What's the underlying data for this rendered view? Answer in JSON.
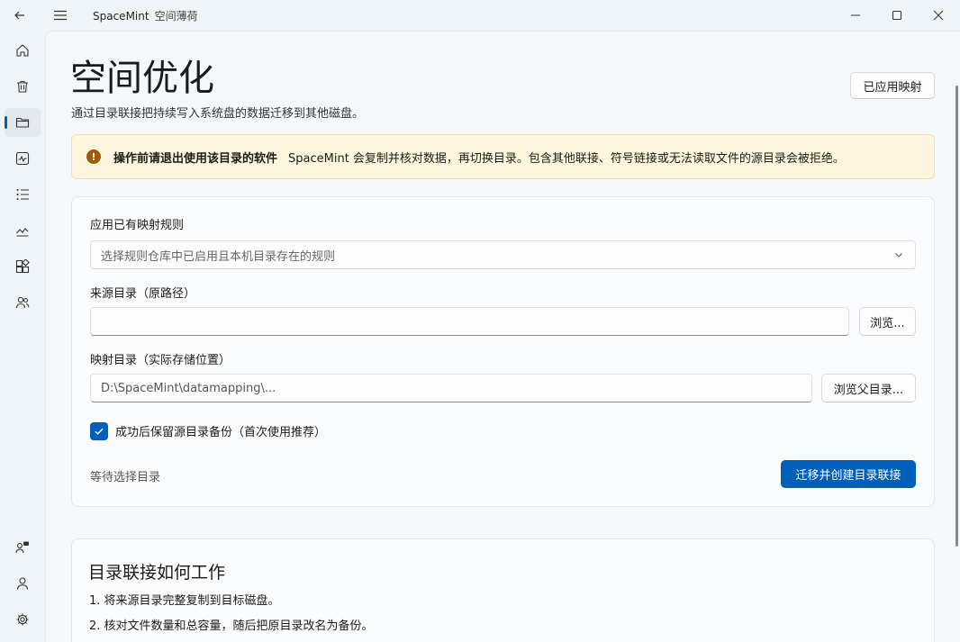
{
  "app": {
    "name": "SpaceMint",
    "subtitle": "空间薄荷"
  },
  "page": {
    "title": "空间优化",
    "description": "通过目录联接把持续写入系统盘的数据迁移到其他磁盘。",
    "applied_button": "已应用映射"
  },
  "warning": {
    "icon": "warning-icon",
    "title": "操作前请退出使用该目录的软件",
    "message": "SpaceMint 会复制并核对数据，再切换目录。包含其他联接、符号链接或无法读取文件的源目录会被拒绝。"
  },
  "form": {
    "rule_label": "应用已有映射规则",
    "rule_placeholder": "选择规则仓库中已启用且本机目录存在的规则",
    "source_label": "来源目录（原路径）",
    "source_value": "",
    "browse_label": "浏览...",
    "mapping_label": "映射目录（实际存储位置）",
    "mapping_value": "D:\\SpaceMint\\datamapping\\...",
    "browse_parent_label": "浏览父目录...",
    "keep_backup_label": "成功后保留源目录备份（首次使用推荐）",
    "keep_backup_checked": true,
    "status": "等待选择目录",
    "primary_button": "迁移并创建目录联接"
  },
  "howto": {
    "title": "目录联接如何工作",
    "steps": [
      "1. 将来源目录完整复制到目标磁盘。",
      "2. 核对文件数量和总容量，随后把原目录改名为备份。"
    ]
  },
  "colors": {
    "accent": "#005fb8",
    "warning_bg": "#fdf6dc",
    "warning_icon": "#9d5d00"
  }
}
